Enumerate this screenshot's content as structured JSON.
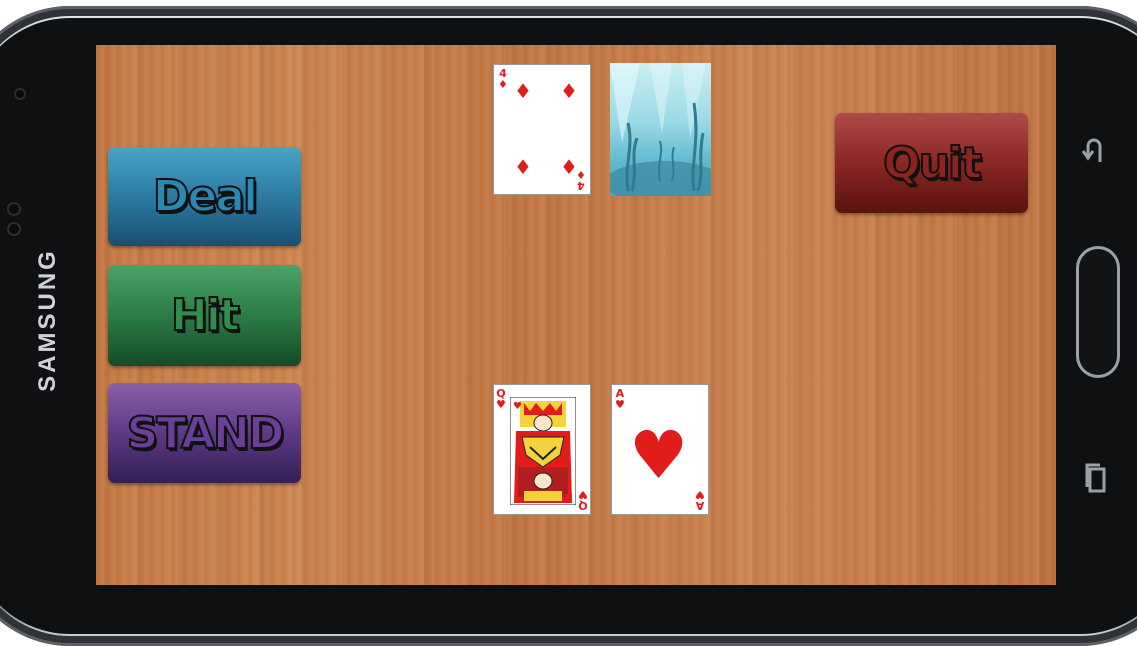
{
  "device": {
    "brand": "SAMSUNG"
  },
  "buttons": {
    "deal": "Deal",
    "hit": "Hit",
    "stand": "STAND",
    "quit": "Quit"
  },
  "dealer": {
    "cards": [
      {
        "rank": "4",
        "suit": "diamonds",
        "face_up": true
      },
      {
        "face_up": false,
        "back": "underwater-card-back"
      }
    ]
  },
  "player": {
    "cards": [
      {
        "rank": "Q",
        "suit": "hearts",
        "face_up": true
      },
      {
        "rank": "A",
        "suit": "hearts",
        "face_up": true
      }
    ]
  },
  "icons": {
    "diamond": "♦",
    "heart": "♥",
    "nav_back": "back-icon",
    "nav_recents": "recents-icon"
  },
  "colors": {
    "card_red": "#e21b1b",
    "deal": "#2b88b3",
    "hit": "#2f8d4f",
    "stand": "#6a3f98",
    "quit": "#8b2321"
  }
}
